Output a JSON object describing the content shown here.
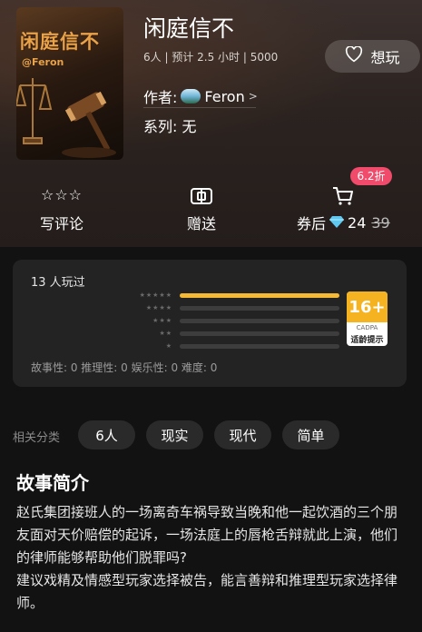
{
  "book": {
    "cover_title": "闲庭信不",
    "cover_sub": "@Feron",
    "title": "闲庭信不",
    "meta": "6人 | 预计 2.5 小时 | 5000",
    "author_label": "作者:",
    "author_name": "Feron",
    "author_arrow": ">",
    "series": "系列: 无"
  },
  "want_button": {
    "label": "想玩",
    "icon": "heart-outline-icon"
  },
  "actions": {
    "review": {
      "label": "写评论",
      "stars": "☆☆☆",
      "icon": "star-outline-icon"
    },
    "gift": {
      "label": "赠送",
      "icon": "gift-icon"
    },
    "buy": {
      "label": "券后",
      "price_now": "24",
      "price_old": "39",
      "discount": "6.2折",
      "icon": "cart-icon",
      "currency_icon": "diamond-icon"
    }
  },
  "ratings": {
    "played": "13 人玩过",
    "rows": [
      {
        "stars": "★★★★★",
        "fraction": 1.0
      },
      {
        "stars": "★★★★",
        "fraction": 0
      },
      {
        "stars": "★★★",
        "fraction": 0
      },
      {
        "stars": "★★",
        "fraction": 0
      },
      {
        "stars": "★",
        "fraction": 0
      }
    ],
    "age_badge": {
      "rating": "16+",
      "org": "CADPA",
      "text": "适龄提示"
    },
    "dimensions": "故事性: 0  推理性: 0  娱乐性: 0  难度: 0"
  },
  "categories": {
    "label": "相关分类",
    "tags": [
      "6人",
      "现实",
      "现代",
      "简单"
    ]
  },
  "synopsis": {
    "title": "故事简介",
    "paragraphs": [
      "赵氏集团接班人的一场离奇车祸导致当晚和他一起饮酒的三个朋友面对天价赔偿的起诉，一场法庭上的唇枪舌辩就此上演，他们的律师能够帮助他们脱罪吗?",
      "建议戏精及情感型玩家选择被告，能言善辩和推理型玩家选择律师。"
    ]
  },
  "colors": {
    "accent": "#f5b935",
    "discount": "#f14b6b",
    "panel": "#232323"
  }
}
